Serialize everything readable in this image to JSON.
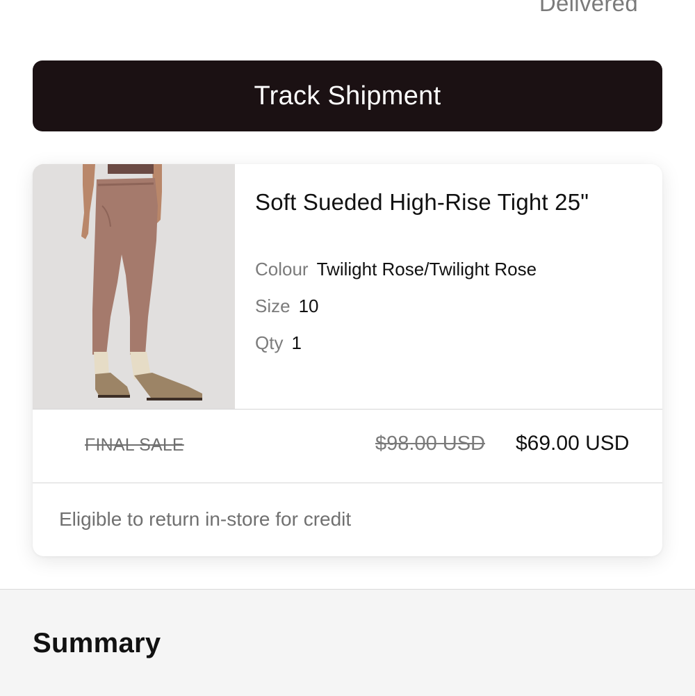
{
  "order": {
    "status": "Delivered"
  },
  "actions": {
    "track_label": "Track Shipment"
  },
  "item": {
    "name": "Soft Sueded High-Rise Tight 25\"",
    "colour_label": "Colour",
    "colour_value": "Twilight Rose/Twilight Rose",
    "size_label": "Size",
    "size_value": "10",
    "qty_label": "Qty",
    "qty_value": "1",
    "final_sale": "FINAL SALE",
    "original_price": "$98.00 USD",
    "sale_price": "$69.00 USD",
    "return_note": "Eligible to return in-store for credit",
    "image_icon": "product-photo-leggings",
    "product_color": "#a57a6c"
  },
  "summary": {
    "title": "Summary"
  },
  "colors": {
    "button_bg": "#1b1113",
    "page_bg": "#ffffff",
    "summary_bg": "#f5f5f5",
    "muted_text": "#7a7a7a"
  }
}
